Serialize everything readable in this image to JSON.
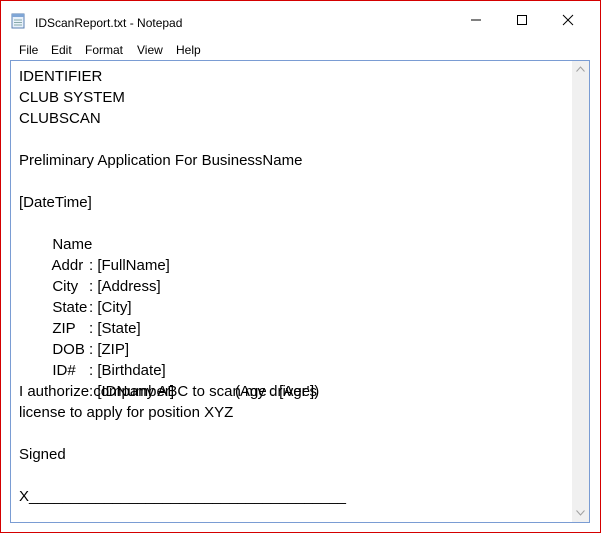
{
  "window": {
    "title": "IDScanReport.txt - Notepad",
    "accent_border": "#d40000",
    "icons": {
      "app": "notepad-icon",
      "minimize": "minimize-icon",
      "maximize": "maximize-icon",
      "close": "close-icon"
    }
  },
  "menubar": {
    "items": [
      "File",
      "Edit",
      "Format",
      "View",
      "Help"
    ]
  },
  "document": {
    "header": [
      "IDENTIFIER",
      "CLUB SYSTEM",
      "CLUBSCAN"
    ],
    "application_title": "Preliminary Application For BusinessName",
    "datetime": "[DateTime]",
    "fields": [
      {
        "label": "Name",
        "value": ": [FullName]"
      },
      {
        "label": "Addr",
        "value": ": [Address]"
      },
      {
        "label": "City",
        "value": ": [City]"
      },
      {
        "label": "State",
        "value": ": [State]"
      },
      {
        "label": "ZIP",
        "value": ": [ZIP]"
      },
      {
        "label": "DOB",
        "value": ": [Birthdate]",
        "extra": "(Age : [Age])"
      },
      {
        "label": "ID#",
        "value": ": [IDNumber]"
      }
    ],
    "authorization": [
      "I authorize company ABC to scan my driver's",
      "license to apply for position XYZ"
    ],
    "signed_label": "Signed",
    "signature_line": "X______________________________________"
  },
  "scrollbar": {
    "icons": {
      "up": "scroll-up-arrow-icon",
      "down": "scroll-down-arrow-icon"
    }
  }
}
